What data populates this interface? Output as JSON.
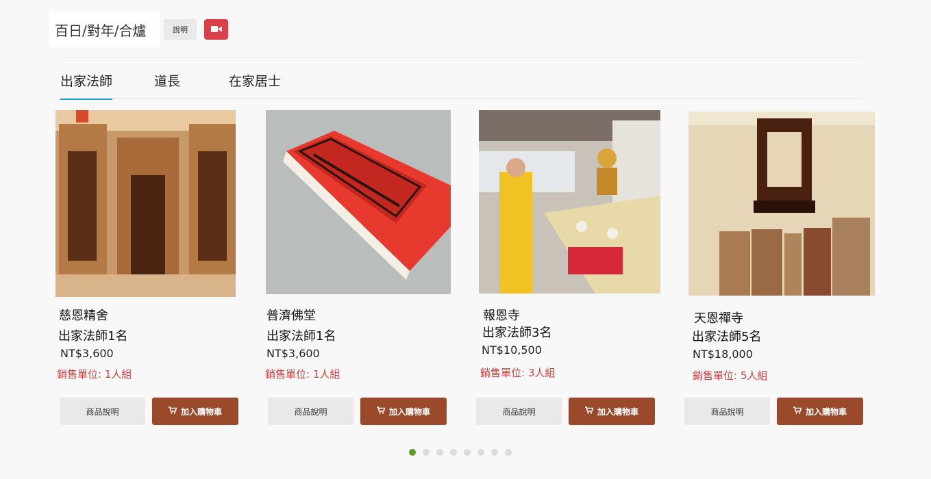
{
  "header": {
    "title": "百日/對年/合爐",
    "desc_button": "說明",
    "video_icon": "video-camera-icon",
    "video_color": "#d9404a"
  },
  "tabs": [
    {
      "label": "出家法師",
      "active": true
    },
    {
      "label": "道長",
      "active": false
    },
    {
      "label": "在家居士",
      "active": false
    }
  ],
  "products": [
    {
      "temple": "慈恩精舍",
      "quota": "出家法師1名",
      "price": "NT$3,600",
      "unit": "銷售單位: 1人組",
      "info_label": "商品說明",
      "cart_label": "加入購物車"
    },
    {
      "temple": "普濟佛堂",
      "quota": "出家法師1名",
      "price": "NT$3,600",
      "unit": "銷售單位: 1人組",
      "info_label": "商品說明",
      "cart_label": "加入購物車"
    },
    {
      "temple": "報恩寺",
      "quota": "出家法師3名",
      "price": "NT$10,500",
      "unit": "銷售單位:  3人組",
      "info_label": "商品說明",
      "cart_label": "加入購物車"
    },
    {
      "temple": "天恩禪寺",
      "quota": "出家法師5名",
      "price": "NT$18,000",
      "unit": "銷售單位:  5人組",
      "info_label": "商品說明",
      "cart_label": "加入購物車"
    }
  ],
  "pagination": {
    "total": 8,
    "current": 1
  },
  "colors": {
    "accent_tab": "#1aa6cf",
    "cart_button": "#9a4a2a",
    "unit_text": "#d23b3b",
    "active_dot": "#5a9a1e"
  }
}
